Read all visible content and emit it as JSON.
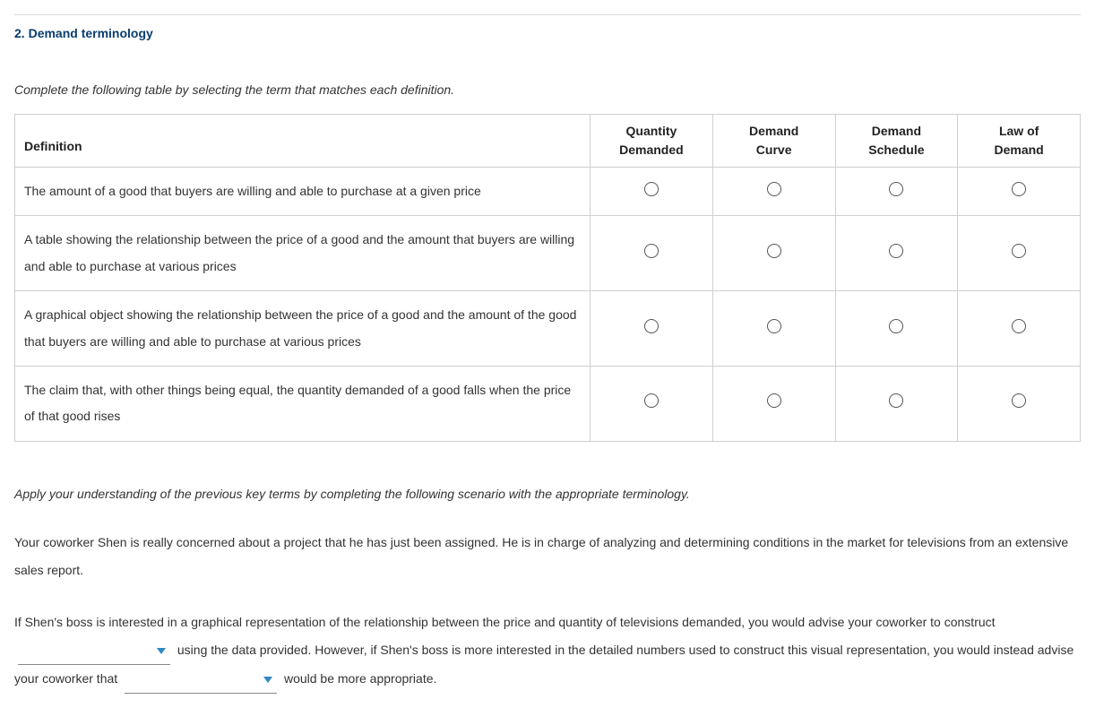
{
  "section": {
    "number": "2.",
    "title": "Demand terminology"
  },
  "table": {
    "prompt": "Complete the following table by selecting the term that matches each definition.",
    "header_definition": "Definition",
    "options": [
      "Quantity\nDemanded",
      "Demand\nCurve",
      "Demand\nSchedule",
      "Law of\nDemand"
    ],
    "definitions": [
      "The amount of a good that buyers are willing and able to purchase at a given price",
      "A table showing the relationship between the price of a good and the amount that buyers are willing and able to purchase at various prices",
      "A graphical object showing the relationship between the price of a good and the amount of the good that buyers are willing and able to purchase at various prices",
      "The claim that, with other things being equal, the quantity demanded of a good falls when the price of that good rises"
    ]
  },
  "scenario": {
    "prompt": "Apply your understanding of the previous key terms by completing the following scenario with the appropriate terminology.",
    "para1": "Your coworker Shen is really concerned about a project that he has just been assigned. He is in charge of analyzing and determining conditions in the market for televisions from an extensive sales report.",
    "para2_pre": "If Shen's boss is interested in a graphical representation of the relationship between the price and quantity of televisions demanded, you would advise your coworker to construct ",
    "para2_mid": " using the data provided. However, if Shen's boss is more interested in the detailed numbers used to construct this visual representation, you would instead advise your coworker that ",
    "para2_post": " would be more appropriate."
  }
}
